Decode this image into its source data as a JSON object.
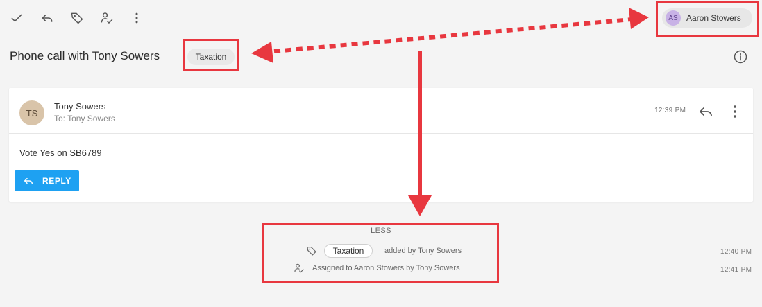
{
  "toolbar": {
    "icons": [
      "checkmark-icon",
      "reply-icon",
      "tag-icon",
      "assign-user-icon",
      "more-vertical-icon"
    ]
  },
  "assignee": {
    "initials": "AS",
    "name": "Aaron Stowers"
  },
  "conversation": {
    "title": "Phone call with Tony Sowers",
    "tag": "Taxation"
  },
  "message": {
    "sender_initials": "TS",
    "sender_name": "Tony Sowers",
    "recipient": "To: Tony Sowers",
    "time": "12:39 PM",
    "body": "Vote Yes on SB6789",
    "reply_label": "REPLY"
  },
  "activity": {
    "toggle_label": "LESS",
    "events": [
      {
        "tag": "Taxation",
        "text": "added by Tony Sowers",
        "time": "12:40 PM",
        "icon": "tag-icon"
      },
      {
        "text": "Assigned to Aaron Stowers by Tony Sowers",
        "time": "12:41 PM",
        "icon": "assign-user-icon"
      }
    ]
  },
  "colors": {
    "annotation": "#e8373f",
    "reply_button": "#1ea1f2"
  }
}
